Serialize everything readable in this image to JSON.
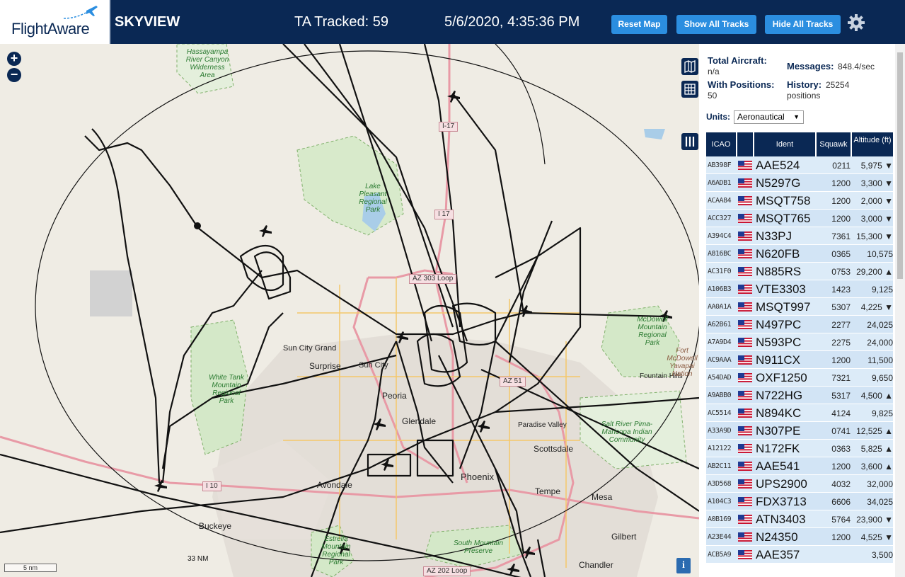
{
  "header": {
    "logo_text": "FlightAware",
    "title": "SKYVIEW",
    "ta_tracked": "TA Tracked: 59",
    "datetime": "5/6/2020, 4:35:36 PM",
    "buttons": {
      "reset": "Reset Map",
      "show": "Show All Tracks",
      "hide": "Hide All Tracks"
    },
    "colors": {
      "bar": "#0a2854",
      "button": "#2b8ee0"
    }
  },
  "map": {
    "zoom_in": "+",
    "zoom_out": "−",
    "scale": "5 nm",
    "ring_label": "33 NM",
    "info": "i",
    "parks": [
      "Hassayampa River Canyon Wilderness Area",
      "Lake Pleasant Regional Park",
      "White Tank Mountain Regional Park",
      "Estrella Mountain Regional Park",
      "McDowell Mountain Regional Park",
      "South Mountain Preserve",
      "Salt River Pima-Maricopa Indian Community"
    ],
    "cities": [
      "Sun City Grand",
      "Surprise",
      "Sun City",
      "Peoria",
      "Glendale",
      "Phoenix",
      "Paradise Valley",
      "Scottsdale",
      "Tempe",
      "Mesa",
      "Avondale",
      "Buckeye",
      "Gilbert",
      "Chandler",
      "Fountain Hills",
      "Fort McDowell Yavapai Nation"
    ],
    "roads": [
      "I-17",
      "I 17",
      "AZ 303 Loop",
      "AZ 51",
      "I 10",
      "AZ 202 Loop"
    ]
  },
  "panel": {
    "total_aircraft_label": "Total Aircraft:",
    "total_aircraft_value": "n/a",
    "with_positions_label": "With Positions:",
    "with_positions_value": "50",
    "messages_label": "Messages:",
    "messages_value": "848.4/sec",
    "history_label": "History:",
    "history_value": "25254 positions",
    "units_label": "Units:",
    "units_value": "Aeronautical",
    "columns": [
      "ICAO",
      "Ident",
      "Squawk",
      "Altitude (ft)"
    ],
    "rows": [
      {
        "icao": "AB398F",
        "ident": "AAE524",
        "squawk": "0211",
        "alt": "5,975 ▼"
      },
      {
        "icao": "A6ADB1",
        "ident": "N5297G",
        "squawk": "1200",
        "alt": "3,300 ▼"
      },
      {
        "icao": "ACAA84",
        "ident": "MSQT758",
        "squawk": "1200",
        "alt": "2,000 ▼"
      },
      {
        "icao": "ACC327",
        "ident": "MSQT765",
        "squawk": "1200",
        "alt": "3,000 ▼"
      },
      {
        "icao": "A394C4",
        "ident": "N33PJ",
        "squawk": "7361",
        "alt": "15,300 ▼"
      },
      {
        "icao": "A816BC",
        "ident": "N620FB",
        "squawk": "0365",
        "alt": "10,575"
      },
      {
        "icao": "AC31F0",
        "ident": "N885RS",
        "squawk": "0753",
        "alt": "29,200 ▲"
      },
      {
        "icao": "A106B3",
        "ident": "VTE3303",
        "squawk": "1423",
        "alt": "9,125"
      },
      {
        "icao": "AA0A1A",
        "ident": "MSQT997",
        "squawk": "5307",
        "alt": "4,225 ▼"
      },
      {
        "icao": "A62B61",
        "ident": "N497PC",
        "squawk": "2277",
        "alt": "24,025"
      },
      {
        "icao": "A7A9D4",
        "ident": "N593PC",
        "squawk": "2275",
        "alt": "24,000"
      },
      {
        "icao": "AC9AAA",
        "ident": "N911CX",
        "squawk": "1200",
        "alt": "11,500"
      },
      {
        "icao": "A54DAD",
        "ident": "OXF1250",
        "squawk": "7321",
        "alt": "9,650"
      },
      {
        "icao": "A9ABB0",
        "ident": "N722HG",
        "squawk": "5317",
        "alt": "4,500 ▲"
      },
      {
        "icao": "AC5514",
        "ident": "N894KC",
        "squawk": "4124",
        "alt": "9,825"
      },
      {
        "icao": "A33A9D",
        "ident": "N307PE",
        "squawk": "0741",
        "alt": "12,525 ▲"
      },
      {
        "icao": "A12122",
        "ident": "N172FK",
        "squawk": "0363",
        "alt": "5,825 ▲"
      },
      {
        "icao": "AB2C11",
        "ident": "AAE541",
        "squawk": "1200",
        "alt": "3,600 ▲"
      },
      {
        "icao": "A3D568",
        "ident": "UPS2900",
        "squawk": "4032",
        "alt": "32,000"
      },
      {
        "icao": "A104C3",
        "ident": "FDX3713",
        "squawk": "6606",
        "alt": "34,025"
      },
      {
        "icao": "A0B169",
        "ident": "ATN3403",
        "squawk": "5764",
        "alt": "23,900 ▼"
      },
      {
        "icao": "A23E44",
        "ident": "N24350",
        "squawk": "1200",
        "alt": "4,525 ▼"
      },
      {
        "icao": "ACB5A9",
        "ident": "AAE357",
        "squawk": "",
        "alt": "3,500"
      }
    ]
  }
}
